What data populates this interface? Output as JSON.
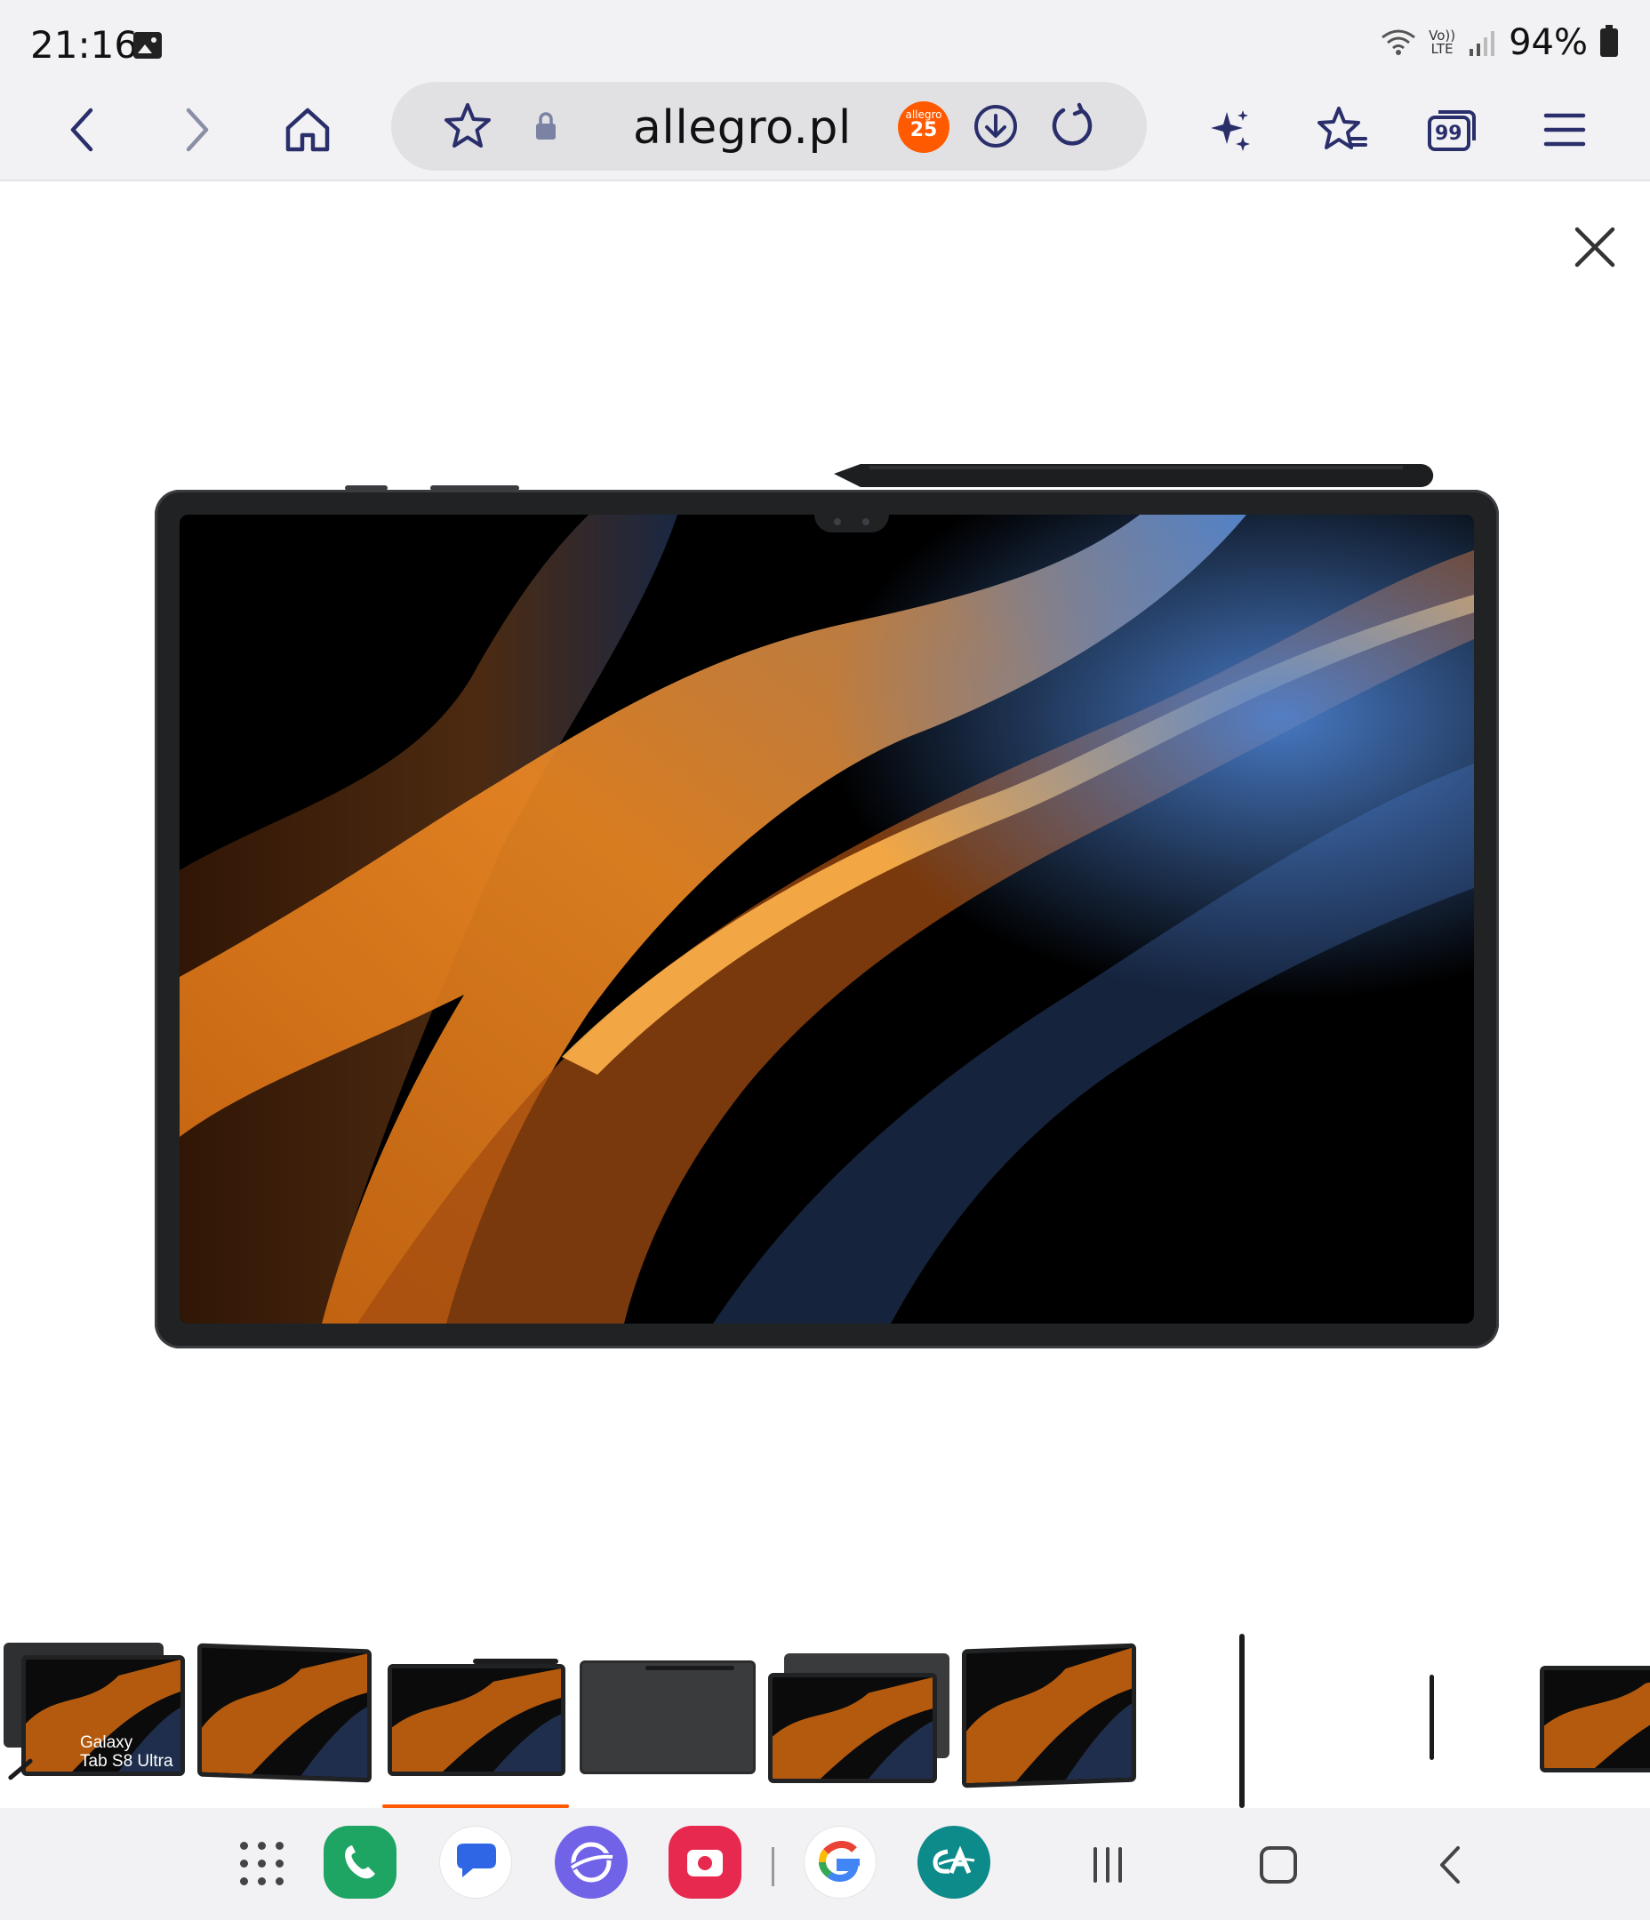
{
  "status_bar": {
    "time": "21:16",
    "network_label": "Vo))\nLTE",
    "battery": "94%",
    "icons": [
      "gallery-icon",
      "wifi-icon",
      "signal-icon",
      "battery-icon"
    ]
  },
  "toolbar": {
    "url": "allegro.pl",
    "badge": {
      "line1": "allegro",
      "line2": "25"
    },
    "icons": [
      "back-icon",
      "forward-icon",
      "home-icon",
      "bookmark-star-icon",
      "lock-icon",
      "download-icon",
      "reload-icon",
      "ai-sparkle-icon",
      "bookmarks-icon",
      "tabs-icon",
      "menu-icon"
    ],
    "tabs_count": "99"
  },
  "viewer": {
    "icons": [
      "close-icon"
    ],
    "thumbnails": [
      {
        "caption": "Galaxy\nTab S8 Ultra"
      }
    ],
    "active_thumbnail": 2
  },
  "taskbar": {
    "apps": [
      "apps-grid-icon",
      "phone-icon",
      "messages-icon",
      "internet-icon",
      "screen-recorder-icon",
      "google-icon",
      "credit-agricole-icon"
    ],
    "nav": [
      "recents-icon",
      "home-nav-icon",
      "back-nav-icon"
    ]
  },
  "colors": {
    "accent_orange": "#ff5a00",
    "bar_bg": "#f2f2f4",
    "device": "#202224"
  }
}
